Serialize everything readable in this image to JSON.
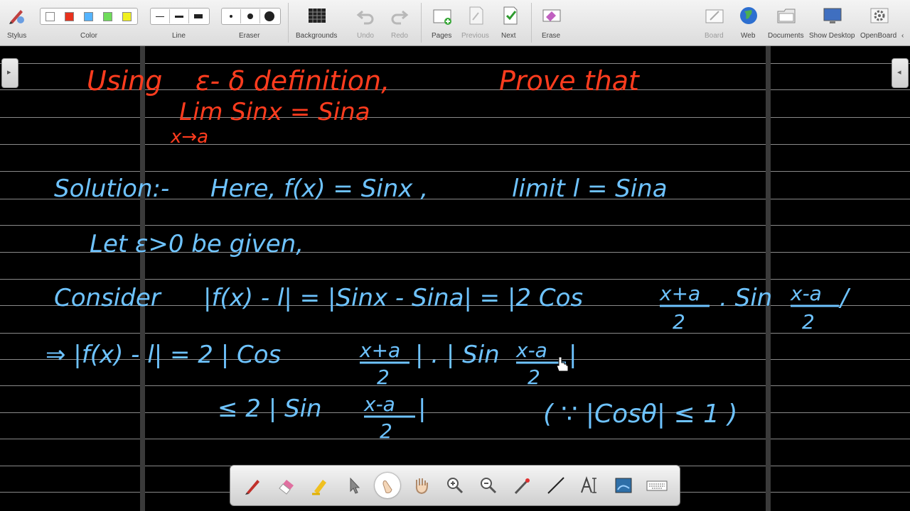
{
  "toolbar": {
    "stylus_label": "Stylus",
    "color_label": "Color",
    "line_label": "Line",
    "eraser_label": "Eraser",
    "backgrounds_label": "Backgrounds",
    "undo_label": "Undo",
    "redo_label": "Redo",
    "pages_label": "Pages",
    "previous_label": "Previous",
    "next_label": "Next",
    "erase_label": "Erase",
    "board_label": "Board",
    "web_label": "Web",
    "documents_label": "Documents",
    "show_desktop_label": "Show Desktop",
    "openboard_label": "OpenBoard",
    "colors": [
      "#ffffff",
      "#e8321e",
      "#55b4ff",
      "#6fdc5a",
      "#f0f020"
    ]
  },
  "ink": {
    "red": "#ff3c1e",
    "blue": "#6ec3ff"
  },
  "board": {
    "title_line1_a": "Using",
    "title_line1_b": "ε- δ definition,",
    "title_line1_c": "Prove that",
    "title_line2": "Lim Sinx = Sina",
    "title_line2_sub": "x→a",
    "sol_line1_a": "Solution:-",
    "sol_line1_b": "Here,  f(x) = Sinx ,",
    "sol_line1_c": "limit l = Sina",
    "sol_line2": "Let  ε>0  be  given,",
    "sol_line3_a": "Consider",
    "sol_line3_b": "|f(x) - l| = |Sinx - Sina| = |2 Cos",
    "sol_line3_num1": "x+a",
    "sol_line3_den1": "2",
    "sol_line3_c": ". Sin",
    "sol_line3_num2": "x-a",
    "sol_line3_den2": "2",
    "sol_line4_a": "⇒  |f(x) - l|  =  2 | Cos",
    "sol_line4_num1": "x+a",
    "sol_line4_den1": "2",
    "sol_line4_b": "| . | Sin",
    "sol_line4_num2": "x-a",
    "sol_line4_den2": "2",
    "sol_line5_a": "≤  2 | Sin",
    "sol_line5_num": "x-a",
    "sol_line5_den": "2",
    "sol_line5_b": "( ∵ |Cosθ| ≤ 1 )"
  }
}
